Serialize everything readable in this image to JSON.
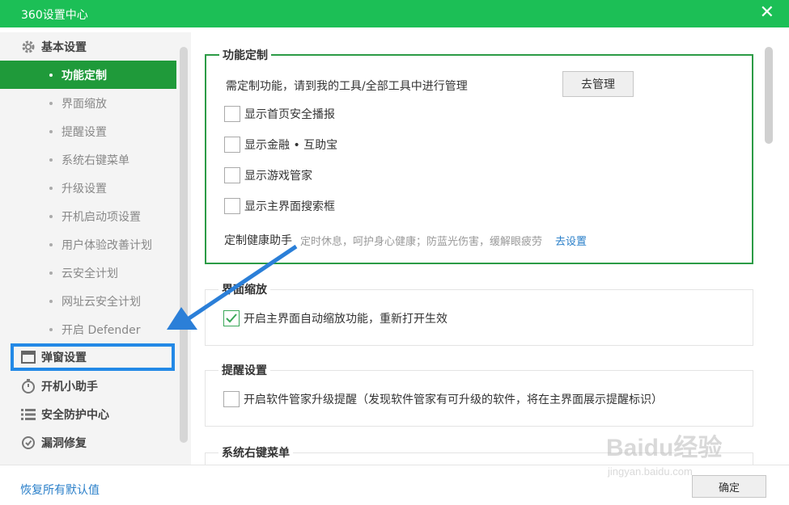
{
  "window": {
    "title": "360设置中心",
    "close_icon": "close-icon"
  },
  "sidebar": {
    "sections": [
      {
        "label": "基本设置",
        "icon": "gear-icon"
      },
      {
        "label": "弹窗设置",
        "icon": "popup-window-icon"
      },
      {
        "label": "开机小助手",
        "icon": "timer-icon"
      },
      {
        "label": "安全防护中心",
        "icon": "list-icon"
      },
      {
        "label": "漏洞修复",
        "icon": "repair-icon"
      }
    ],
    "items": [
      "功能定制",
      "界面缩放",
      "提醒设置",
      "系统右键菜单",
      "升级设置",
      "开机启动项设置",
      "用户体验改善计划",
      "云安全计划",
      "网址云安全计划",
      "开启 Defender"
    ],
    "active_item": "功能定制",
    "highlighted_section": "弹窗设置"
  },
  "main": {
    "custom": {
      "legend": "功能定制",
      "hint": "需定制功能，请到我的工具/全部工具中进行管理",
      "manage_button": "去管理",
      "options": [
        {
          "label": "显示首页安全播报",
          "checked": false
        },
        {
          "label": "显示金融 • 互助宝",
          "checked": false
        },
        {
          "label": "显示游戏管家",
          "checked": false
        },
        {
          "label": "显示主界面搜索框",
          "checked": false
        }
      ],
      "health": {
        "label": "定制健康助手",
        "desc": "定时休息，呵护身心健康；防蓝光伤害，缓解眼疲劳",
        "link": "去设置"
      }
    },
    "zoom": {
      "legend": "界面缩放",
      "option": {
        "label": "开启主界面自动缩放功能，重新打开生效",
        "checked": true
      }
    },
    "remind": {
      "legend": "提醒设置",
      "option": {
        "label": "开启软件管家升级提醒（发现软件管家有可升级的软件，将在主界面展示提醒标识）",
        "checked": false
      }
    },
    "context_menu": {
      "legend": "系统右键菜单"
    }
  },
  "footer": {
    "restore_link": "恢复所有默认值",
    "ok_button": "确定"
  },
  "watermark": {
    "logo": "Baidu经验",
    "url": "jingyan.baidu.com"
  },
  "colors": {
    "titlebar": "#1cbf56",
    "active_item": "#1f9a3a",
    "group_border": "#2c9b46",
    "highlight": "#2389e6",
    "arrow": "#2b7fd8",
    "link": "#2a7fc9"
  }
}
